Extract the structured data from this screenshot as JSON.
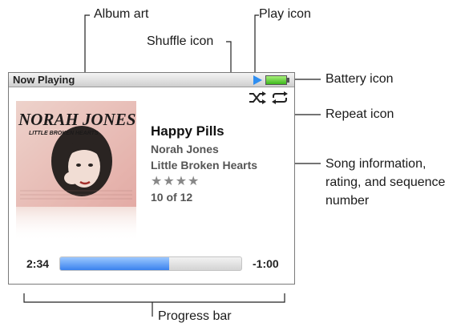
{
  "labels": {
    "album_art": "Album art",
    "play_icon": "Play icon",
    "shuffle_icon": "Shuffle icon",
    "battery_icon": "Battery icon",
    "repeat_icon": "Repeat icon",
    "song_info_line1": "Song information,",
    "song_info_line2": "rating, and sequence",
    "song_info_line3": "number",
    "progress_bar": "Progress bar"
  },
  "screen": {
    "title": "Now Playing",
    "song": {
      "title": "Happy Pills",
      "artist": "Norah Jones",
      "album": "Little Broken Hearts",
      "rating_stars": "★★★★",
      "rating": 4,
      "sequence": "10 of 12"
    },
    "album_art": {
      "artist_text": "NORAH JONES",
      "album_text": "LITTLE BROKEN HEARTS"
    },
    "progress": {
      "elapsed": "2:34",
      "remaining": "-1:00",
      "fraction": 0.6
    }
  },
  "colors": {
    "play": "#2f8ef0",
    "battery": "#3db81d",
    "progress": "#3a82ee"
  }
}
